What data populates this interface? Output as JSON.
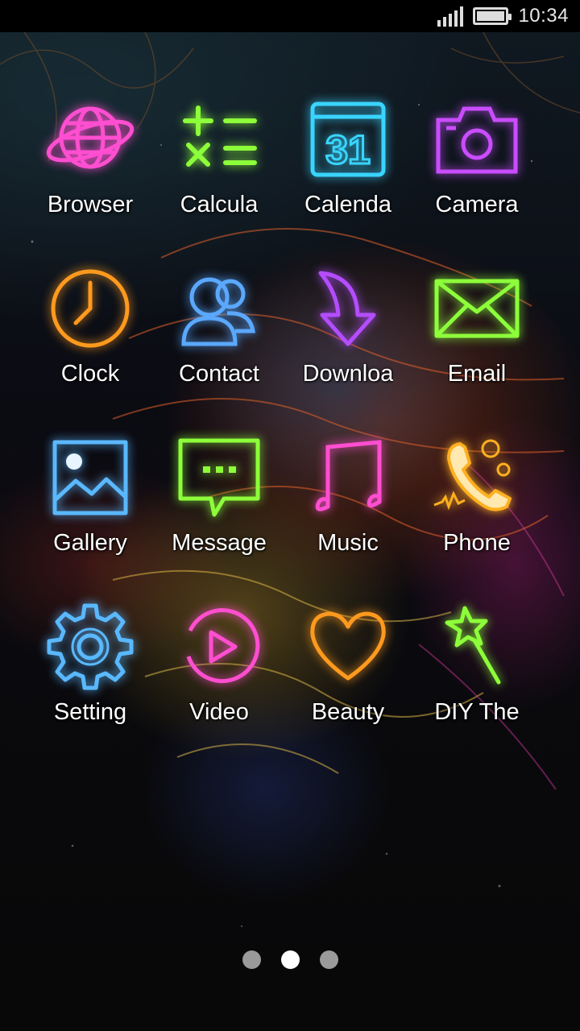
{
  "status_bar": {
    "time": "10:34",
    "signal_icon": "signal-icon",
    "battery_icon": "battery-icon"
  },
  "apps": [
    {
      "label": "Browser",
      "icon": "globe-icon",
      "color": "#ff4fd0"
    },
    {
      "label": "Calcula",
      "icon": "calculator-icon",
      "color": "#8dff3a"
    },
    {
      "label": "Calenda",
      "icon": "calendar-icon",
      "color": "#39d4ff"
    },
    {
      "label": "Camera",
      "icon": "camera-icon",
      "color": "#c94dff"
    },
    {
      "label": "Clock",
      "icon": "clock-icon",
      "color": "#ff9a1f"
    },
    {
      "label": "Contact",
      "icon": "contacts-icon",
      "color": "#5aa8ff"
    },
    {
      "label": "Downloa",
      "icon": "download-icon",
      "color": "#b44dff"
    },
    {
      "label": "Email",
      "icon": "envelope-icon",
      "color": "#8dff3a"
    },
    {
      "label": "Gallery",
      "icon": "image-icon",
      "color": "#5ab8ff"
    },
    {
      "label": "Message",
      "icon": "message-icon",
      "color": "#8dff3a"
    },
    {
      "label": "Music",
      "icon": "music-note-icon",
      "color": "#ff4fd0"
    },
    {
      "label": "Phone",
      "icon": "phone-icon",
      "color": "#ffb020"
    },
    {
      "label": "Setting",
      "icon": "gear-icon",
      "color": "#5ab8ff"
    },
    {
      "label": "Video",
      "icon": "play-icon",
      "color": "#ff4fd0"
    },
    {
      "label": "Beauty",
      "icon": "heart-icon",
      "color": "#ff9a1f"
    },
    {
      "label": "DIY The",
      "icon": "magic-wand-icon",
      "color": "#8dff3a"
    }
  ],
  "page_indicator": {
    "total": 3,
    "current": 2
  }
}
